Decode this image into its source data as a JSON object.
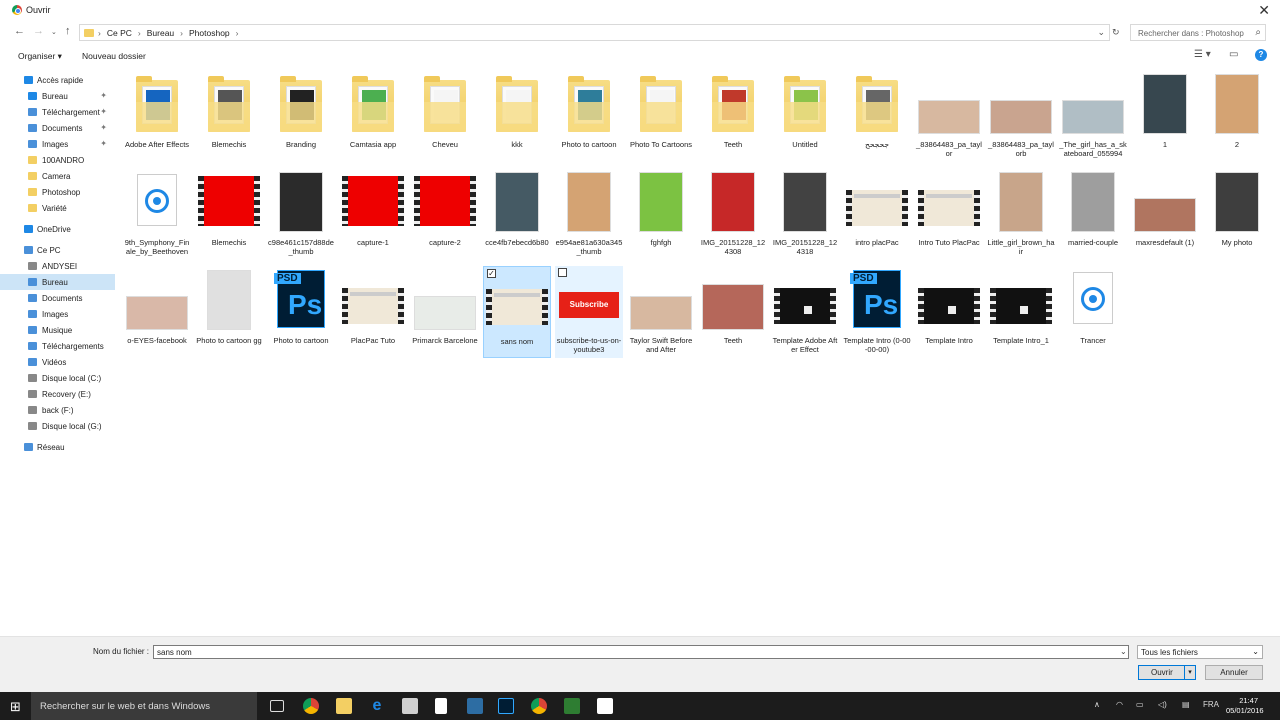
{
  "window": {
    "title": "Ouvrir"
  },
  "address": {
    "crumbs": [
      "Ce PC",
      "Bureau",
      "Photoshop"
    ],
    "search_placeholder": "Rechercher dans : Photoshop"
  },
  "toolbar": {
    "organize": "Organiser ▾",
    "new_folder": "Nouveau dossier",
    "help": "?"
  },
  "sidebar": {
    "quick_access": "Accès rapide",
    "quick_items": [
      "Bureau",
      "Téléchargement",
      "Documents",
      "Images",
      "100ANDRO",
      "Camera",
      "Photoshop",
      "Variété"
    ],
    "onedrive": "OneDrive",
    "this_pc": "Ce PC",
    "pc_items": [
      "ANDYSEI",
      "Bureau",
      "Documents",
      "Images",
      "Musique",
      "Téléchargements",
      "Vidéos",
      "Disque local (C:)",
      "Recovery (E:)",
      "back (F:)",
      "Disque local (G:)"
    ],
    "network": "Réseau"
  },
  "files": [
    {
      "name": "Adobe After Effects",
      "kind": "folder",
      "color": "#1565c0"
    },
    {
      "name": "Blemechis",
      "kind": "folder",
      "color": "#555555"
    },
    {
      "name": "Branding",
      "kind": "folder",
      "color": "#222222"
    },
    {
      "name": "Camtasia app",
      "kind": "folder",
      "color": "#4caf50"
    },
    {
      "name": "Cheveu",
      "kind": "folder",
      "color": "#f5f5f5"
    },
    {
      "name": "kkk",
      "kind": "folder",
      "color": "#f5f5f5"
    },
    {
      "name": "Photo to cartoon",
      "kind": "folder",
      "color": "#2e7d9a"
    },
    {
      "name": "Photo To Cartoons",
      "kind": "folder",
      "color": "#f5f5f5"
    },
    {
      "name": "Teeth",
      "kind": "folder",
      "color": "#c0392b"
    },
    {
      "name": "Untitled",
      "kind": "folder",
      "color": "#8bc34a"
    },
    {
      "name": "جحجحح",
      "kind": "folder",
      "color": "#666666"
    },
    {
      "name": "_83864483_pa_taylor",
      "kind": "photo",
      "color": "#d7b8a0"
    },
    {
      "name": "_83864483_pa_taylorb",
      "kind": "photo",
      "color": "#c9a48f"
    },
    {
      "name": "_The_girl_has_a_skateboard_055994",
      "kind": "photo",
      "color": "#b0bec5"
    },
    {
      "name": "1",
      "kind": "photo",
      "color": "#37474f"
    },
    {
      "name": "2",
      "kind": "photo",
      "color": "#d4a373"
    },
    {
      "name": "9th_Symphony_Finale_by_Beethoven",
      "kind": "doc",
      "color": "#1e88e5"
    },
    {
      "name": "Blemechis",
      "kind": "video",
      "color": "#e00000"
    },
    {
      "name": "c98e461c157d88de_thumb",
      "kind": "photo",
      "color": "#2b2b2b"
    },
    {
      "name": "capture-1",
      "kind": "video",
      "color": "#e00000"
    },
    {
      "name": "capture-2",
      "kind": "video",
      "color": "#e00000"
    },
    {
      "name": "cce4fb7ebecd6b80",
      "kind": "photo",
      "color": "#455a64"
    },
    {
      "name": "e954ae81a630a345_thumb",
      "kind": "photo",
      "color": "#d4a373"
    },
    {
      "name": "fghfgh",
      "kind": "photo",
      "color": "#7cc242"
    },
    {
      "name": "IMG_20151228_124308",
      "kind": "photo",
      "color": "#c62828"
    },
    {
      "name": "IMG_20151228_124318",
      "kind": "photo",
      "color": "#424242"
    },
    {
      "name": "intro placPac",
      "kind": "frame",
      "color": "#f0e8d8"
    },
    {
      "name": "Intro Tuto PlacPac",
      "kind": "frame",
      "color": "#f0e8d8"
    },
    {
      "name": "Little_girl_brown_hair",
      "kind": "photo",
      "color": "#c8a58a"
    },
    {
      "name": "married-couple",
      "kind": "photo",
      "color": "#9e9e9e"
    },
    {
      "name": "maxresdefault (1)",
      "kind": "photo",
      "color": "#b07560"
    },
    {
      "name": "My photo",
      "kind": "photo",
      "color": "#3e3e3e"
    },
    {
      "name": "o-EYES-facebook",
      "kind": "photo",
      "color": "#d9b8a8"
    },
    {
      "name": "Photo to cartoon gg",
      "kind": "photo",
      "color": "#e0e0e0"
    },
    {
      "name": "Photo to cartoon",
      "kind": "psd",
      "color": "#001d34"
    },
    {
      "name": "PlacPac Tuto",
      "kind": "frame",
      "color": "#f0e8d8"
    },
    {
      "name": "Primarck Barcelone",
      "kind": "photo",
      "color": "#e8ece8"
    },
    {
      "name": "sans nom",
      "kind": "frame",
      "color": "#f0e8d8"
    },
    {
      "name": "subscribe-to-us-on-youtube3",
      "kind": "yt",
      "color": "#e62117"
    },
    {
      "name": "Taylor Swift Before and After",
      "kind": "photo",
      "color": "#d7b8a0"
    },
    {
      "name": "Teeth",
      "kind": "photo",
      "color": "#b5675a"
    },
    {
      "name": "Template Adobe After Effect",
      "kind": "dark",
      "color": "#111111"
    },
    {
      "name": "Template Intro (0-00-00-00)",
      "kind": "psd",
      "color": "#001d34"
    },
    {
      "name": "Template Intro",
      "kind": "dark",
      "color": "#111111"
    },
    {
      "name": "Template Intro_1",
      "kind": "dark",
      "color": "#111111"
    },
    {
      "name": "Trancer",
      "kind": "doc",
      "color": "#1e88e5"
    }
  ],
  "yt_label": "Subscribe",
  "psd_label": "PSD",
  "ps_label": "Ps",
  "bottom": {
    "filename_label": "Nom du fichier :",
    "filename_value": "sans nom",
    "filetype": "Tous les fichiers",
    "open": "Ouvrir",
    "cancel": "Annuler"
  },
  "taskbar": {
    "search": "Rechercher sur le web et dans Windows",
    "lang": "FRA",
    "time": "21:47",
    "date": "05/01/2016"
  }
}
